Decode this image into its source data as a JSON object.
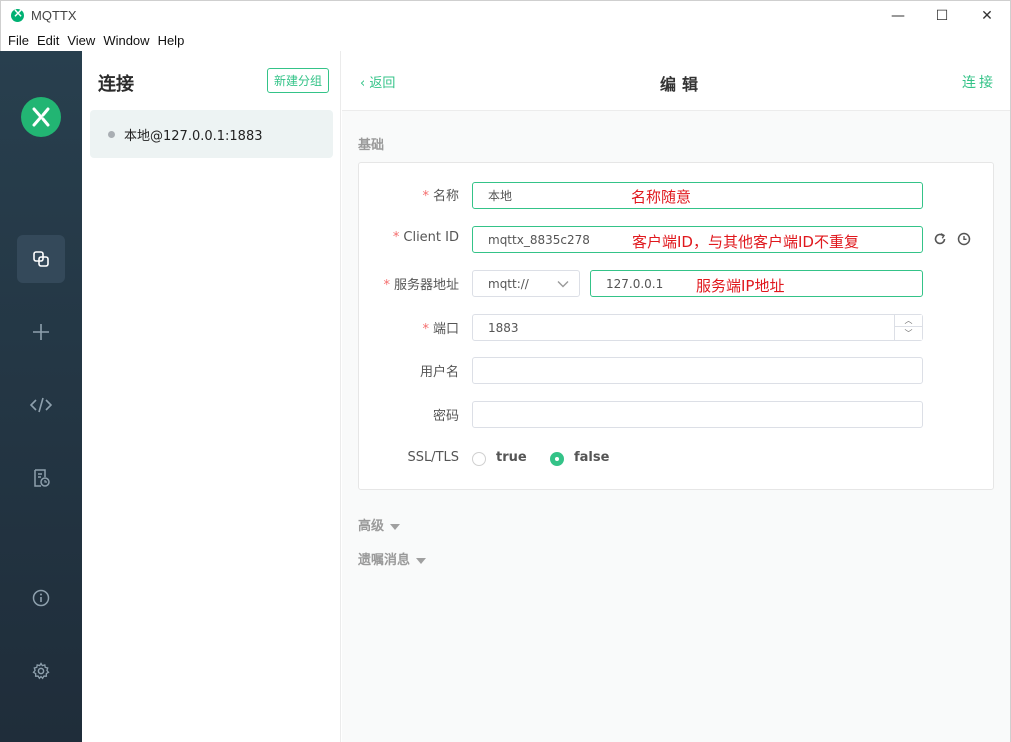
{
  "window": {
    "title": "MQTTX",
    "minimize": "—",
    "maximize": "☐",
    "close": "✕"
  },
  "menu": [
    "File",
    "Edit",
    "View",
    "Window",
    "Help"
  ],
  "sidebar": {
    "icons": [
      "connections-icon",
      "plus-icon",
      "code-icon",
      "log-icon",
      "info-icon",
      "gear-icon"
    ]
  },
  "connections": {
    "title": "连接",
    "new_group": "新建分组",
    "items": [
      {
        "name": "本地@127.0.0.1:1883"
      }
    ]
  },
  "header": {
    "back": "返回",
    "title": "编辑",
    "connect": "连接"
  },
  "basic": {
    "section": "基础",
    "name_label": "名称",
    "name_value": "本地",
    "name_note": "名称随意",
    "client_id_label": "Client ID",
    "client_id_value": "mqttx_8835c278",
    "client_id_note": "客户端ID，与其他客户端ID不重复",
    "host_label": "服务器地址",
    "protocol": "mqtt://",
    "host_value": "127.0.0.1",
    "host_note": "服务端IP地址",
    "port_label": "端口",
    "port_value": "1883",
    "username_label": "用户名",
    "password_label": "密码",
    "ssl_label": "SSL/TLS",
    "ssl_true": "true",
    "ssl_false": "false",
    "ssl_selected": "false"
  },
  "advanced": {
    "label": "高级"
  },
  "will": {
    "label": "遗嘱消息"
  },
  "colors": {
    "accent": "#34c388",
    "sidebar": "#243644",
    "annotation": "#e0181d"
  }
}
